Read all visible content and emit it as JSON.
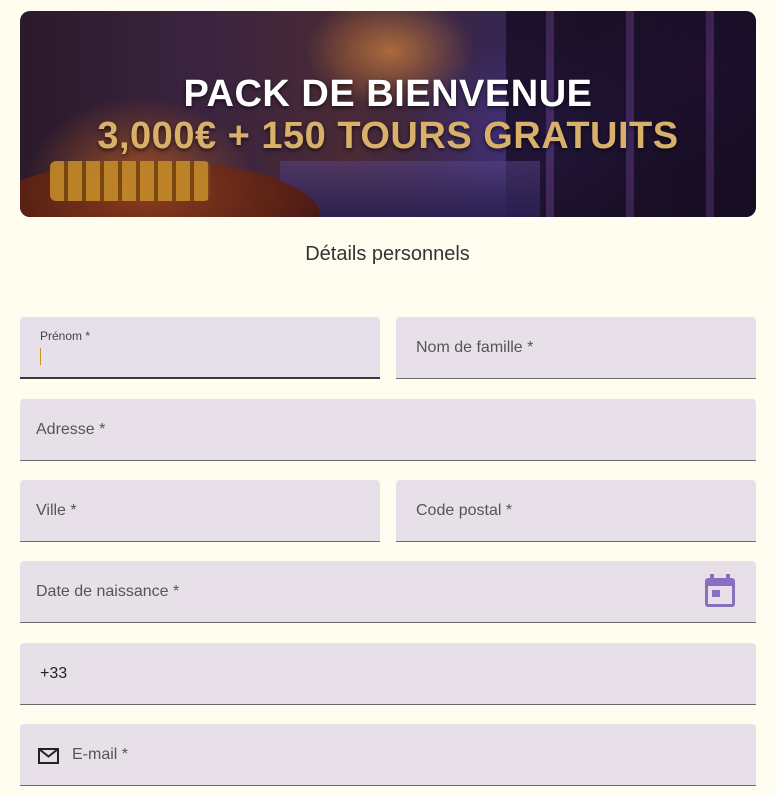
{
  "banner": {
    "title": "PACK DE BIENVENUE",
    "subtitle": "3,000€ + 150 TOURS GRATUITS"
  },
  "form": {
    "section_title": "Détails personnels",
    "first_name": {
      "label": "Prénom *",
      "value": ""
    },
    "last_name": {
      "label": "Nom de famille *"
    },
    "address": {
      "label": "Adresse *"
    },
    "city": {
      "label": "Ville *"
    },
    "postal_code": {
      "label": "Code postal *"
    },
    "birth_date": {
      "label": "Date de naissance *",
      "icon": "calendar-icon"
    },
    "phone": {
      "value": "+33"
    },
    "email": {
      "label": "E-mail *",
      "icon": "mail-icon"
    }
  },
  "colors": {
    "page_background": "#fffdf0",
    "field_background": "#e8e0e8",
    "accent_gold": "#d9b06a",
    "calendar_icon": "#8a6fc0",
    "caret": "#c8921e"
  }
}
